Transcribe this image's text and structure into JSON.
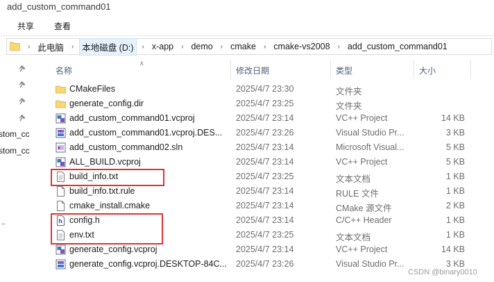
{
  "window": {
    "title": "add_custom_command01"
  },
  "ribbon": {
    "tabs": [
      "共享",
      "查看"
    ]
  },
  "address": {
    "crumbs": [
      "此电脑",
      "本地磁盘 (D:)",
      "x-app",
      "demo",
      "cmake",
      "cmake-vs2008",
      "add_custom_command01"
    ]
  },
  "nav": {
    "partial_items": [
      "stom_cc",
      "stom_cc"
    ]
  },
  "columns": {
    "name": "名称",
    "date": "修改日期",
    "type": "类型",
    "size": "大小"
  },
  "files": [
    {
      "name": "CMakeFiles",
      "date": "2025/4/7 23:30",
      "type": "文件夹",
      "size": "",
      "icon": "folder-icon"
    },
    {
      "name": "generate_config.dir",
      "date": "2025/4/7 23:25",
      "type": "文件夹",
      "size": "",
      "icon": "folder-icon"
    },
    {
      "name": "add_custom_command01.vcproj",
      "date": "2025/4/7 23:14",
      "type": "VC++ Project",
      "size": "14 KB",
      "icon": "vcproj-icon"
    },
    {
      "name": "add_custom_command01.vcproj.DES...",
      "date": "2025/4/7 23:26",
      "type": "Visual Studio Pr...",
      "size": "3 KB",
      "icon": "vs-user-icon"
    },
    {
      "name": "add_custom_command02.sln",
      "date": "2025/4/7 23:14",
      "type": "Microsoft Visual...",
      "size": "5 KB",
      "icon": "sln-icon"
    },
    {
      "name": "ALL_BUILD.vcproj",
      "date": "2025/4/7 23:14",
      "type": "VC++ Project",
      "size": "5 KB",
      "icon": "vcproj-icon"
    },
    {
      "name": "build_info.txt",
      "date": "2025/4/7 23:25",
      "type": "文本文档",
      "size": "1 KB",
      "icon": "text-file-icon"
    },
    {
      "name": "build_info.txt.rule",
      "date": "2025/4/7 23:14",
      "type": "RULE 文件",
      "size": "1 KB",
      "icon": "blank-file-icon"
    },
    {
      "name": "cmake_install.cmake",
      "date": "2025/4/7 23:14",
      "type": "CMake 源文件",
      "size": "2 KB",
      "icon": "blank-file-icon"
    },
    {
      "name": "config.h",
      "date": "2025/4/7 23:14",
      "type": "C/C++ Header",
      "size": "1 KB",
      "icon": "header-file-icon"
    },
    {
      "name": "env.txt",
      "date": "2025/4/7 23:25",
      "type": "文本文档",
      "size": "1 KB",
      "icon": "text-file-icon"
    },
    {
      "name": "generate_config.vcproj",
      "date": "2025/4/7 23:14",
      "type": "VC++ Project",
      "size": "14 KB",
      "icon": "vcproj-icon"
    },
    {
      "name": "generate_config.vcproj.DESKTOP-84C...",
      "date": "2025/4/7 23:26",
      "type": "Visual Studio Pr...",
      "size": "3 KB",
      "icon": "vs-user-icon"
    }
  ],
  "watermark": "CSDN @binary0010",
  "colors": {
    "highlight_border": "#e03131",
    "folder": "#f8d775",
    "accent": "#0078d7"
  }
}
